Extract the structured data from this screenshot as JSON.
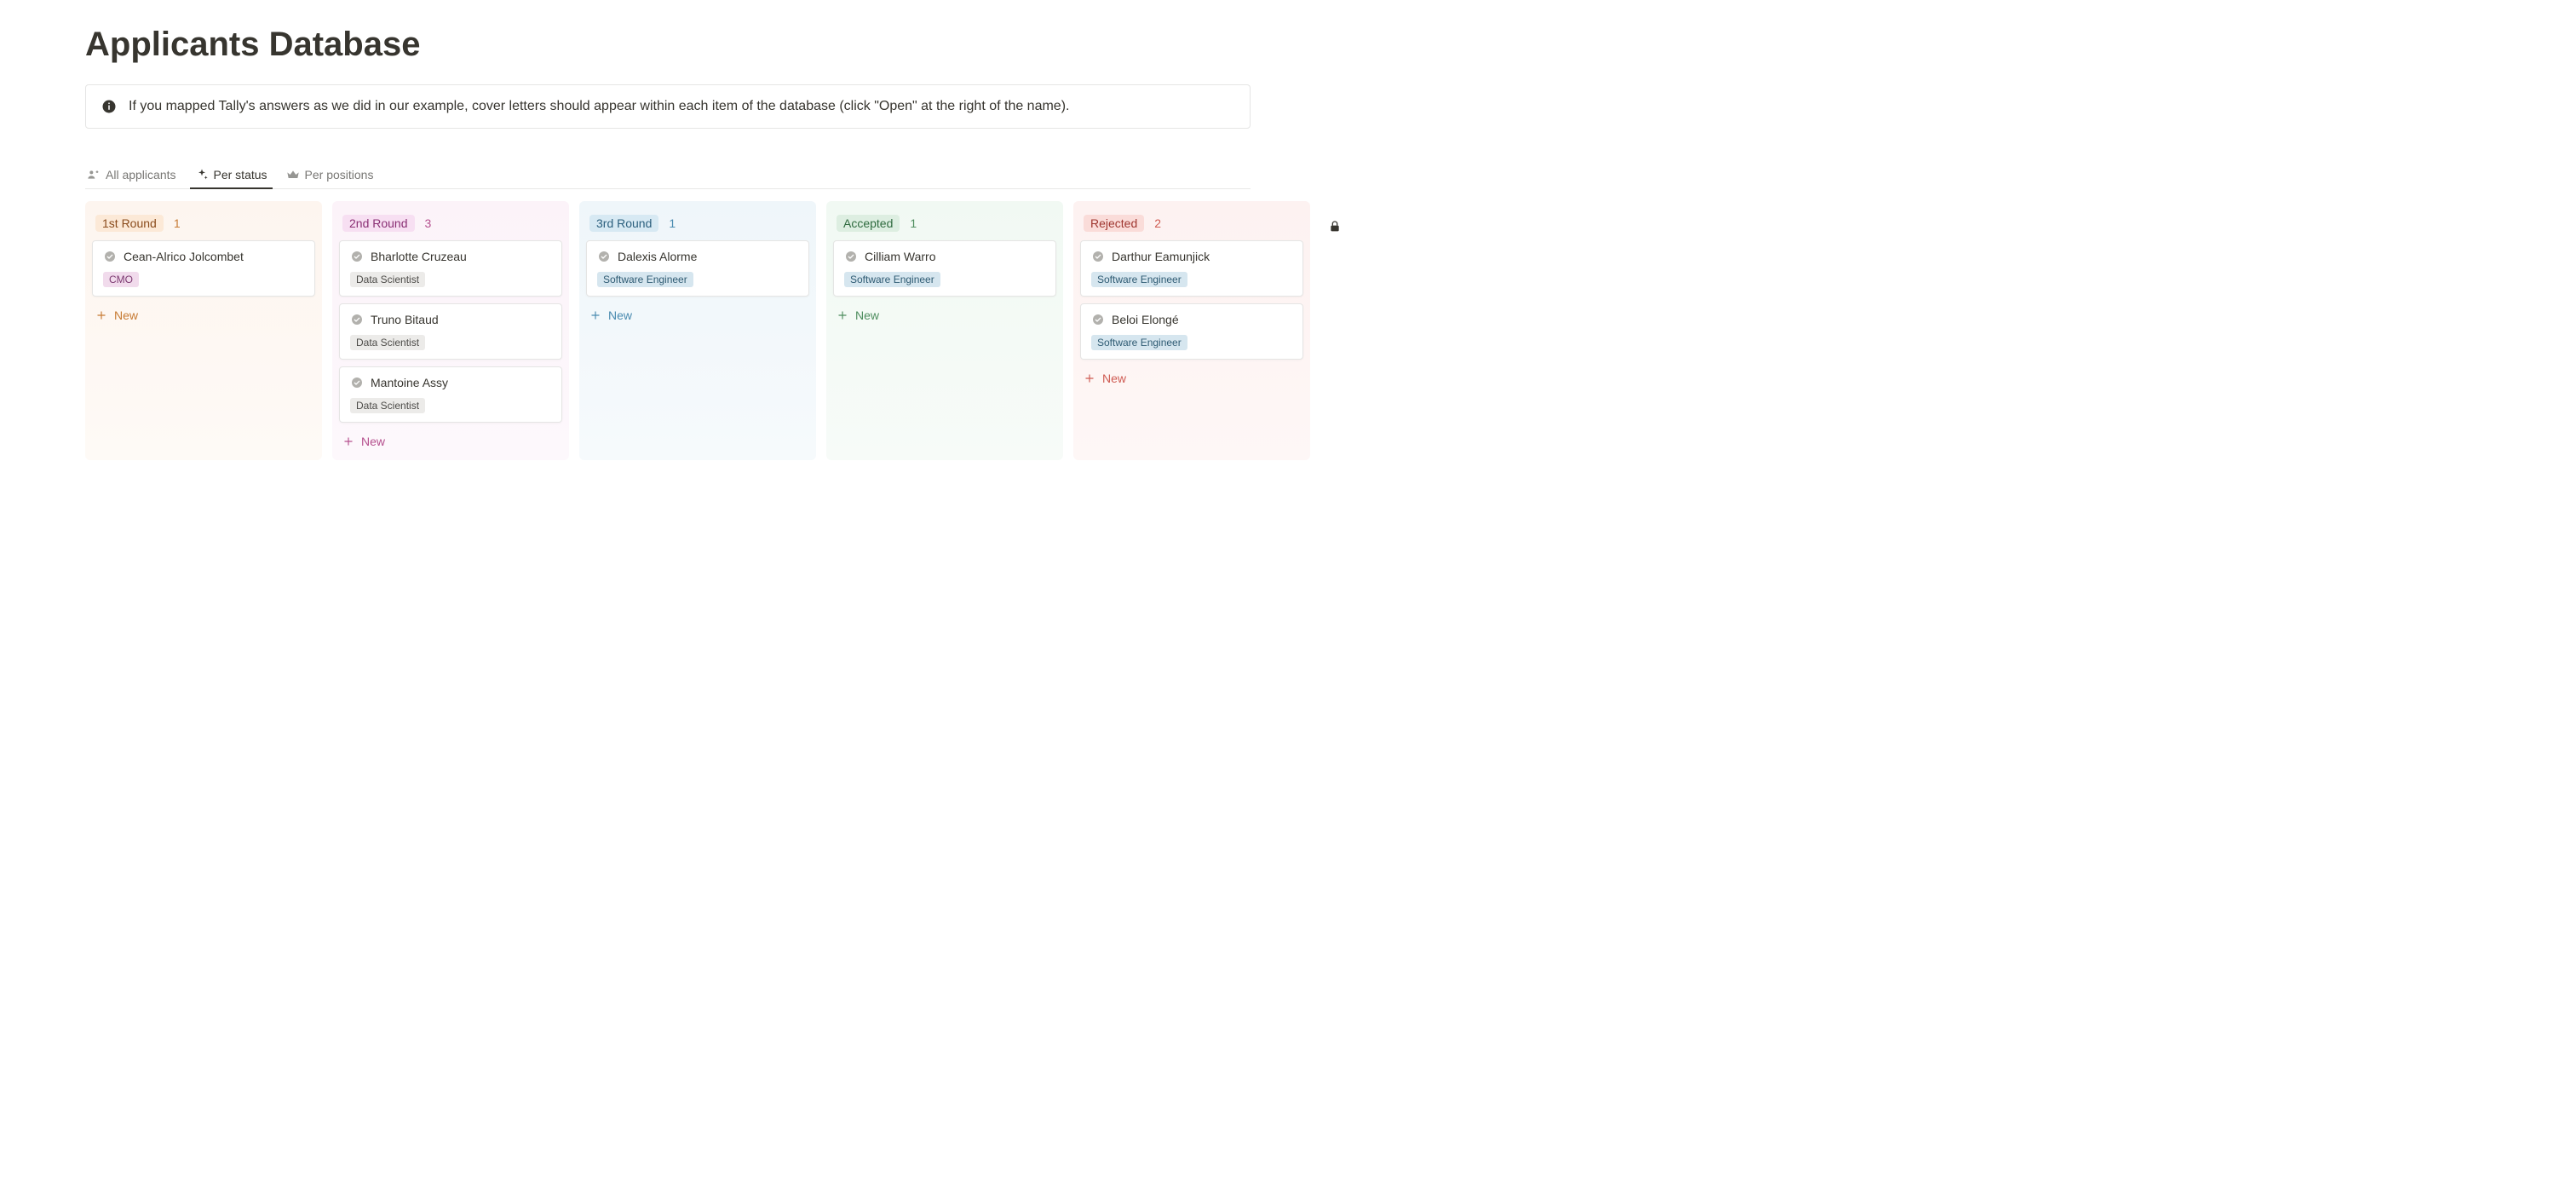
{
  "title": "Applicants Database",
  "callout": "If you mapped Tally's answers as we did in our example, cover letters should appear within each item of the database (click \"Open\" at the right of the name).",
  "tabs": {
    "all": "All applicants",
    "status": "Per status",
    "positions": "Per positions"
  },
  "newLabel": "New",
  "columns": [
    {
      "id": "round1",
      "label": "1st Round",
      "count": "1",
      "tint": "orange",
      "cards": [
        {
          "name": "Cean-Alrico Jolcombet",
          "tag": "CMO",
          "tagClass": "tag-cmo"
        }
      ]
    },
    {
      "id": "round2",
      "label": "2nd Round",
      "count": "3",
      "tint": "pink",
      "cards": [
        {
          "name": "Bharlotte Cruzeau",
          "tag": "Data Scientist",
          "tagClass": "tag-ds"
        },
        {
          "name": "Truno Bitaud",
          "tag": "Data Scientist",
          "tagClass": "tag-ds"
        },
        {
          "name": "Mantoine Assy",
          "tag": "Data Scientist",
          "tagClass": "tag-ds"
        }
      ]
    },
    {
      "id": "round3",
      "label": "3rd Round",
      "count": "1",
      "tint": "blue",
      "cards": [
        {
          "name": "Dalexis Alorme",
          "tag": "Software Engineer",
          "tagClass": "tag-se"
        }
      ]
    },
    {
      "id": "accepted",
      "label": "Accepted",
      "count": "1",
      "tint": "green",
      "cards": [
        {
          "name": "Cilliam Warro",
          "tag": "Software Engineer",
          "tagClass": "tag-se"
        }
      ]
    },
    {
      "id": "rejected",
      "label": "Rejected",
      "count": "2",
      "tint": "red",
      "cards": [
        {
          "name": "Darthur Eamunjick",
          "tag": "Software Engineer",
          "tagClass": "tag-se"
        },
        {
          "name": "Beloi Elongé",
          "tag": "Software Engineer",
          "tagClass": "tag-se"
        }
      ]
    }
  ]
}
